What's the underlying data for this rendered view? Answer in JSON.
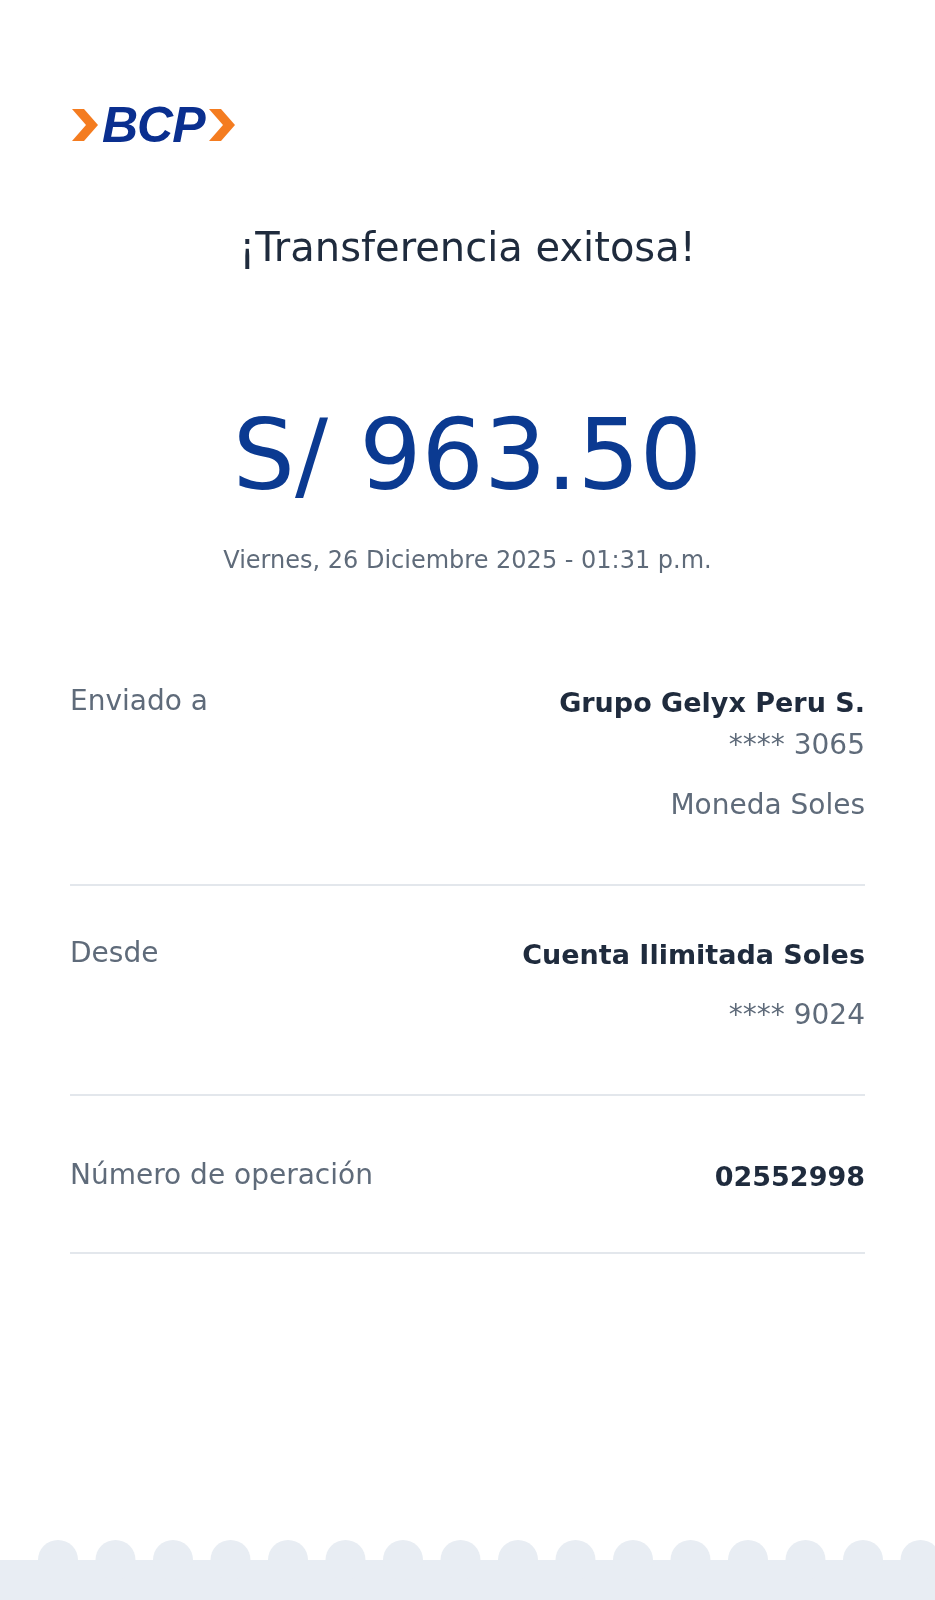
{
  "logo": {
    "text": "BCP"
  },
  "title": "¡Transferencia exitosa!",
  "amount": "S/ 963.50",
  "datetime": "Viernes, 26 Diciembre 2025 - 01:31 p.m.",
  "details": [
    {
      "label": "Enviado a",
      "lines": [
        {
          "text": "Grupo Gelyx Peru S.",
          "kind": "strong"
        },
        {
          "text": "**** 3065",
          "kind": "account"
        },
        {
          "text": "Moneda Soles",
          "kind": "note"
        }
      ]
    },
    {
      "label": "Desde",
      "lines": [
        {
          "text": "Cuenta Ilimitada Soles",
          "kind": "strong"
        },
        {
          "text": "**** 9024",
          "kind": "note"
        }
      ]
    },
    {
      "label": "Número de operación",
      "lines": [
        {
          "text": "02552998",
          "kind": "strong"
        }
      ]
    }
  ]
}
